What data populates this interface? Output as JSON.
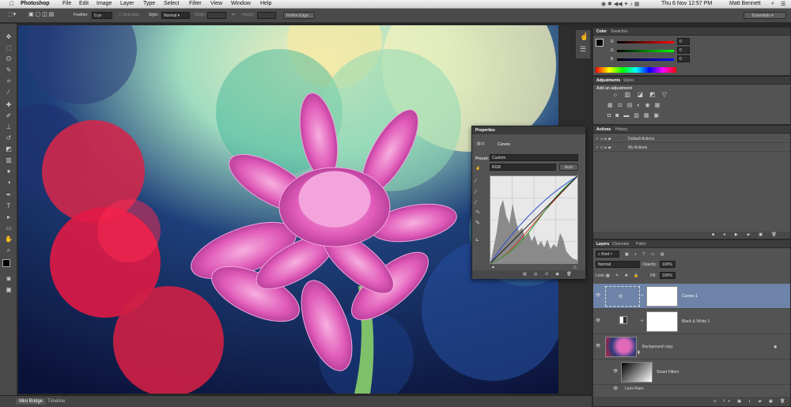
{
  "menubar": {
    "app": "Photoshop",
    "items": [
      "File",
      "Edit",
      "Image",
      "Layer",
      "Type",
      "Select",
      "Filter",
      "View",
      "Window",
      "Help"
    ],
    "datetime": "Thu 6 Nov  12:57 PM",
    "user": "Matt Bennett"
  },
  "options": {
    "feather_label": "Feather:",
    "feather_value": "0 px",
    "antialias": "Anti-alias",
    "style_label": "Style:",
    "style_value": "Normal",
    "width_label": "Width:",
    "height_label": "Height:",
    "refine_edge": "Refine Edge...",
    "workspace": "Essentials"
  },
  "bottom_tabs": [
    "Mini Bridge",
    "Timeline"
  ],
  "color_panel": {
    "tabs": [
      "Color",
      "Swatches"
    ],
    "channels": [
      {
        "label": "R",
        "value": "0",
        "color": "#d23030"
      },
      {
        "label": "G",
        "value": "0",
        "color": "#30b040"
      },
      {
        "label": "B",
        "value": "0",
        "color": "#3050d0"
      }
    ]
  },
  "adjustments_panel": {
    "tabs": [
      "Adjustments",
      "Styles"
    ],
    "heading": "Add an adjustment"
  },
  "actions_panel": {
    "tabs": [
      "Actions",
      "History"
    ],
    "items": [
      "Default Actions",
      "My Actions"
    ]
  },
  "layers_panel": {
    "tabs": [
      "Layers",
      "Channels",
      "Paths"
    ],
    "kind": "Kind",
    "blend_mode": "Normal",
    "opacity_label": "Opacity:",
    "opacity_value": "100%",
    "lock_label": "Lock:",
    "fill_label": "Fill:",
    "fill_value": "100%",
    "layers": [
      {
        "name": "Curves 1"
      },
      {
        "name": "Black & White 1"
      },
      {
        "name": "Background copy"
      },
      {
        "name": "Smart Filters"
      },
      {
        "name": "Lens Flare"
      }
    ]
  },
  "properties_panel": {
    "title": "Properties",
    "adjustment": "Curves",
    "preset_label": "Preset:",
    "preset_value": "Custom",
    "channel": "RGB",
    "auto": "Auto"
  }
}
